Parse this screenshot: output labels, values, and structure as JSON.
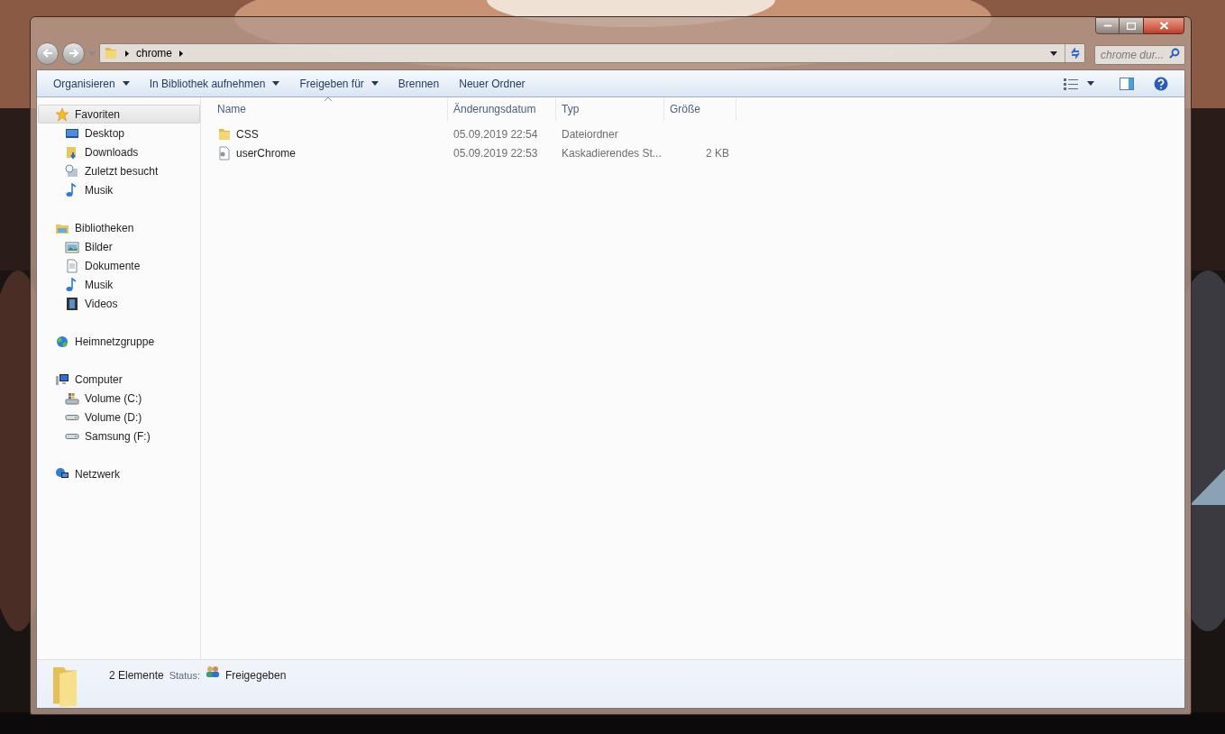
{
  "address_bar": {
    "crumbs": [
      "chrome"
    ]
  },
  "search": {
    "placeholder": "chrome dur..."
  },
  "toolbar": {
    "items": [
      {
        "label": "Organisieren",
        "dropdown": true
      },
      {
        "label": "In Bibliothek aufnehmen",
        "dropdown": true
      },
      {
        "label": "Freigeben für",
        "dropdown": true
      },
      {
        "label": "Brennen",
        "dropdown": false
      },
      {
        "label": "Neuer Ordner",
        "dropdown": false
      }
    ]
  },
  "sidebar": {
    "groups": [
      {
        "label": "Favoriten",
        "kind": "star",
        "selected": true,
        "children": [
          {
            "label": "Desktop",
            "kind": "desktop",
            "selected": false
          },
          {
            "label": "Downloads",
            "kind": "downloads",
            "selected": false
          },
          {
            "label": "Zuletzt besucht",
            "kind": "recent",
            "selected": false
          },
          {
            "label": "Musik",
            "kind": "music",
            "selected": false
          }
        ]
      },
      {
        "label": "Bibliotheken",
        "kind": "library",
        "selected": false,
        "children": [
          {
            "label": "Bilder",
            "kind": "pictures",
            "selected": false
          },
          {
            "label": "Dokumente",
            "kind": "documents",
            "selected": false
          },
          {
            "label": "Musik",
            "kind": "music",
            "selected": false
          },
          {
            "label": "Videos",
            "kind": "videos",
            "selected": false
          }
        ]
      },
      {
        "label": "Heimnetzgruppe",
        "kind": "homegroup",
        "selected": false
      },
      {
        "label": "Computer",
        "kind": "computer",
        "selected": false,
        "children": [
          {
            "label": "Volume (C:)",
            "kind": "system_drive",
            "selected": false
          },
          {
            "label": "Volume (D:)",
            "kind": "drive",
            "selected": false
          },
          {
            "label": "Samsung (F:)",
            "kind": "drive",
            "selected": false
          }
        ]
      },
      {
        "label": "Netzwerk",
        "kind": "network",
        "selected": false
      }
    ]
  },
  "table": {
    "columns": [
      "Name",
      "Änderungsdatum",
      "Typ",
      "Größe"
    ],
    "rows": [
      {
        "kind": "folder",
        "name": "CSS",
        "date": "05.09.2019 22:54",
        "type": "Dateiordner"
      },
      {
        "kind": "file",
        "name": "userChrome",
        "date": "05.09.2019 22:53",
        "type": "Kaskadierendes St...",
        "size": "2 KB"
      }
    ]
  },
  "details": {
    "count": "2 Elemente",
    "status_label": "Status:",
    "status": "Freigegeben"
  }
}
